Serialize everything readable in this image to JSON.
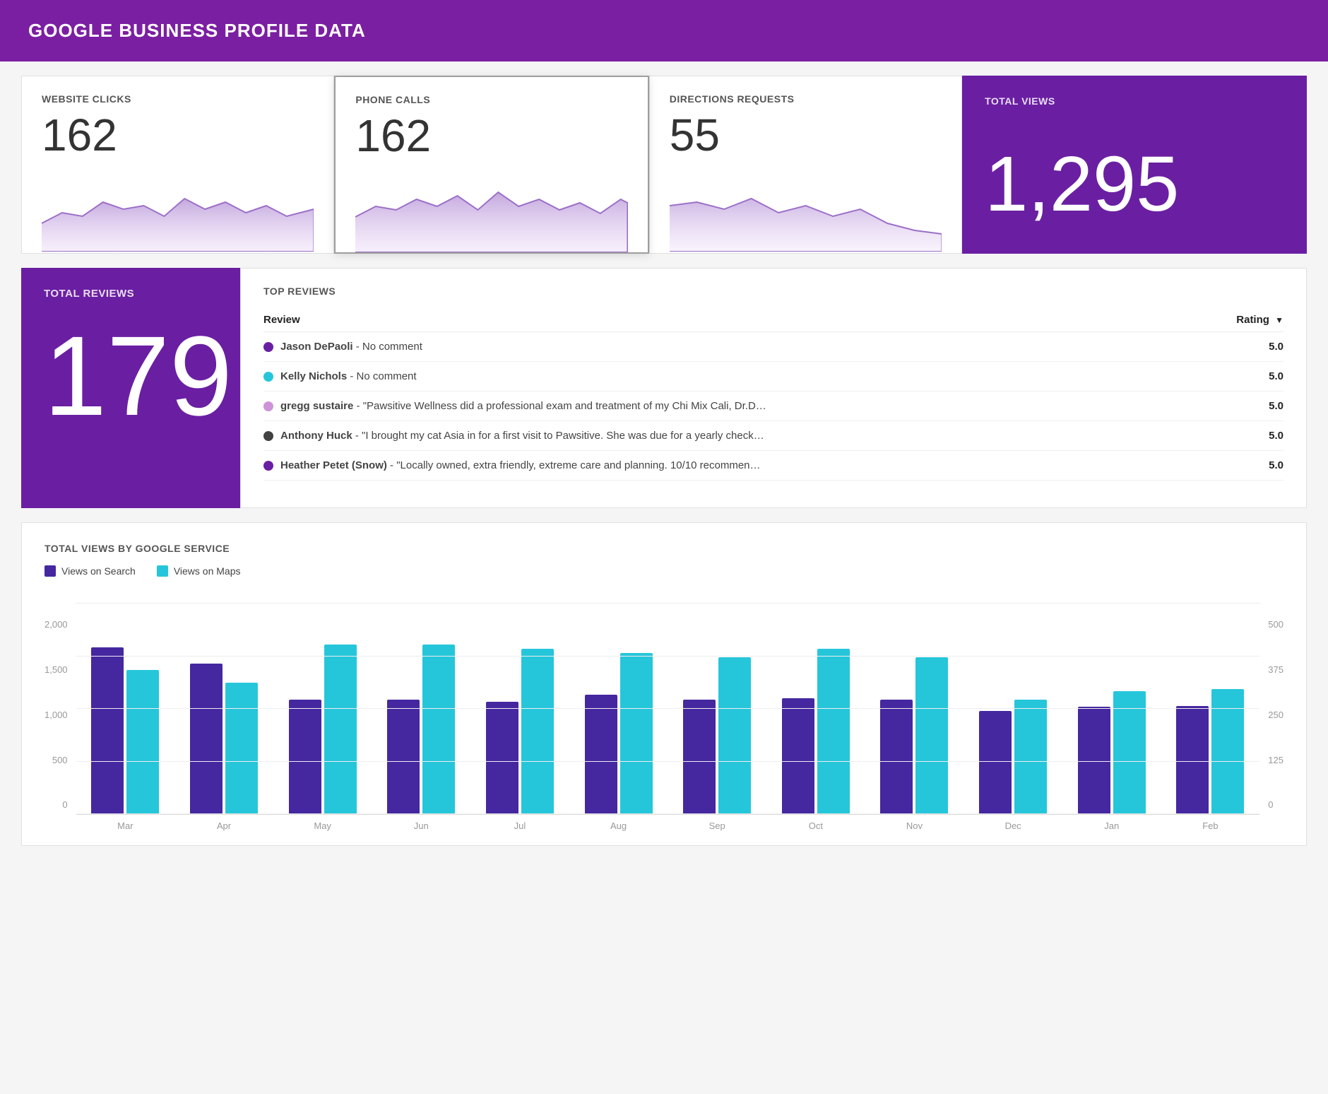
{
  "header": {
    "title": "GOOGLE BUSINESS PROFILE DATA"
  },
  "metrics": {
    "website_clicks": {
      "label": "WEBSITE CLICKS",
      "value": "162"
    },
    "phone_calls": {
      "label": "PHONE CALLS",
      "value": "162"
    },
    "directions_requests": {
      "label": "DIRECTIONS REQUESTS",
      "value": "55"
    },
    "total_views": {
      "label": "TOTAL VIEWS",
      "value": "1,295"
    }
  },
  "reviews": {
    "total_label": "TOTAL REVIEWS",
    "total_value": "179",
    "top_reviews_label": "TOP REVIEWS",
    "table": {
      "col_review": "Review",
      "col_rating": "Rating",
      "rows": [
        {
          "name": "Jason DePaoli",
          "comment": "No comment",
          "rating": "5.0",
          "color": "#6a1fa2"
        },
        {
          "name": "Kelly Nichols",
          "comment": "No comment",
          "rating": "5.0",
          "color": "#26c6da"
        },
        {
          "name": "gregg sustaire",
          "comment": "\"Pawsitive Wellness did a professional exam and treatment of my Chi Mix Cali, Dr.D…",
          "rating": "5.0",
          "color": "#ce93d8"
        },
        {
          "name": "Anthony Huck",
          "comment": "\"I brought my cat Asia in for a first visit to Pawsitive. She was due for a yearly check…",
          "rating": "5.0",
          "color": "#424242"
        },
        {
          "name": "Heather Petet (Snow)",
          "comment": "\"Locally owned, extra friendly, extreme care and planning. 10/10 recommen…",
          "rating": "5.0",
          "color": "#6a1fa2"
        }
      ]
    }
  },
  "bar_chart": {
    "title": "TOTAL VIEWS BY GOOGLE SERVICE",
    "legend": [
      {
        "label": "Views on Search",
        "color": "#4527a0"
      },
      {
        "label": "Views on Maps",
        "color": "#26c6da"
      }
    ],
    "y_axis_left": [
      "2,000",
      "1,500",
      "1,000",
      "500",
      "0"
    ],
    "y_axis_right": [
      "500",
      "375",
      "250",
      "125",
      "0"
    ],
    "months": [
      "Mar",
      "Apr",
      "May",
      "Jun",
      "Jul",
      "Aug",
      "Sep",
      "Oct",
      "Nov",
      "Dec",
      "Jan",
      "Feb"
    ],
    "search_values": [
      1570,
      1420,
      1080,
      1080,
      1060,
      1130,
      1080,
      1090,
      1080,
      970,
      1010,
      1020
    ],
    "maps_values": [
      340,
      310,
      400,
      400,
      390,
      380,
      370,
      390,
      370,
      270,
      290,
      295
    ],
    "max_search": 2000,
    "max_maps": 500
  },
  "colors": {
    "purple_dark": "#6a1fa2",
    "purple_header": "#7b1fa2",
    "teal": "#26c6da",
    "light_purple": "#ce93d8"
  }
}
